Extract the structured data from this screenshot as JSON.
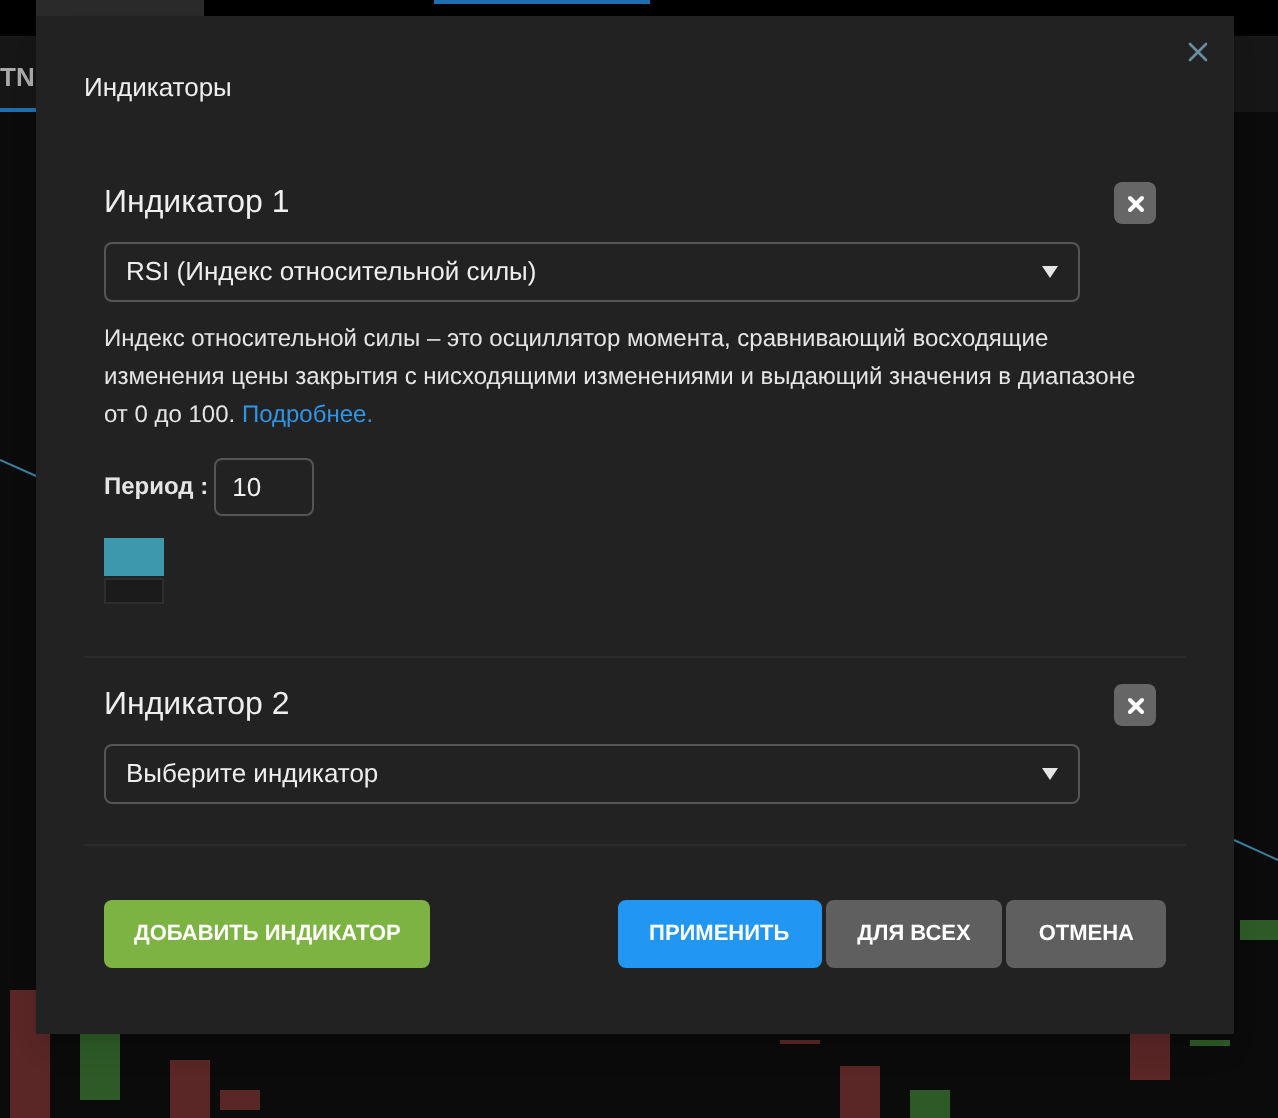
{
  "background": {
    "tab": "TN"
  },
  "dialog": {
    "title": "Индикаторы",
    "indicators": [
      {
        "title": "Индикатор 1",
        "select": {
          "value": "RSI (Индекс относительной силы)"
        },
        "description": "Индекс относительной силы – это осциллятор момента, сравнивающий восходящие изменения цены закрытия с нисходящими изменениями и выдающий значения в диапазоне от 0 до 100.",
        "more_link": "Подробнее.",
        "period_label": "Период :",
        "period_value": "10",
        "colors": [
          {
            "color": "#3d97ad"
          },
          {
            "color": "#1b1b1b"
          }
        ]
      },
      {
        "title": "Индикатор 2",
        "select": {
          "placeholder": "Выберите индикатор"
        }
      }
    ],
    "add_button": "ДОБАВИТЬ ИНДИКАТОР",
    "buttons": [
      {
        "label": "ПРИМЕНИТЬ",
        "kind": "primary"
      },
      {
        "label": "ДЛЯ ВСЕХ",
        "kind": "secondary"
      },
      {
        "label": "ОТМЕНА",
        "kind": "secondary"
      }
    ]
  }
}
